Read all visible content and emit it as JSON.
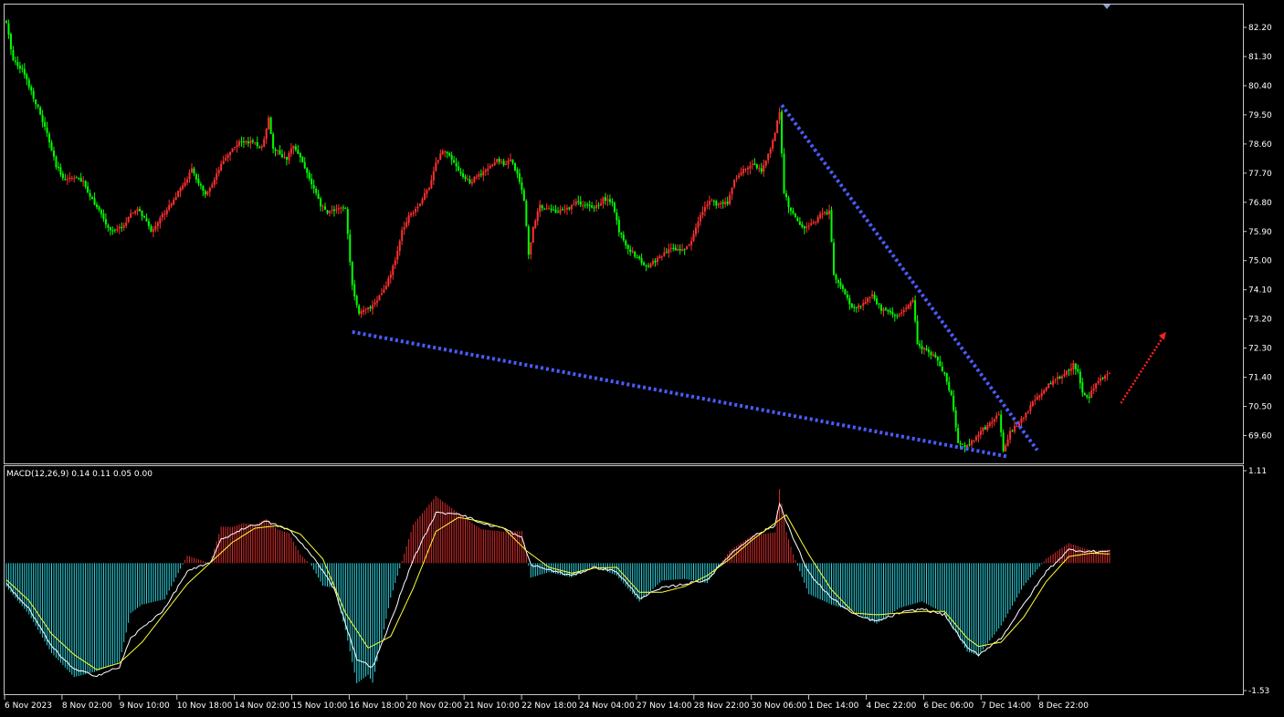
{
  "chart_data": [
    {
      "type": "candlestick",
      "instrument": "",
      "ylim": [
        68.8,
        83.0
      ],
      "y_ticks": [
        "82.20",
        "81.30",
        "80.40",
        "79.50",
        "78.60",
        "77.70",
        "76.80",
        "75.90",
        "75.00",
        "74.10",
        "73.20",
        "72.30",
        "71.40",
        "70.50",
        "69.60"
      ],
      "x_ticks": [
        "6 Nov 2023",
        "8 Nov 02:00",
        "9 Nov 10:00",
        "10 Nov 18:00",
        "14 Nov 02:00",
        "15 Nov 10:00",
        "16 Nov 18:00",
        "20 Nov 02:00",
        "21 Nov 10:00",
        "22 Nov 18:00",
        "24 Nov 04:00",
        "27 Nov 14:00",
        "28 Nov 22:00",
        "30 Nov 06:00",
        "1 Dec 14:00",
        "4 Dec 22:00",
        "6 Dec 06:00",
        "7 Dec 14:00",
        "8 Dec 22:00"
      ],
      "colors": {
        "bull": "#ff3030",
        "bear": "#00ff00",
        "trendline": "#4a5cff",
        "arrow": "#ff2020"
      },
      "close_path": [
        [
          0,
          82.3
        ],
        [
          3,
          81.2
        ],
        [
          7,
          80.9
        ],
        [
          10,
          80.4
        ],
        [
          14,
          79.7
        ],
        [
          18,
          78.9
        ],
        [
          22,
          77.9
        ],
        [
          26,
          77.5
        ],
        [
          30,
          77.6
        ],
        [
          34,
          77.4
        ],
        [
          38,
          76.9
        ],
        [
          42,
          76.4
        ],
        [
          45,
          76.0
        ],
        [
          48,
          75.9
        ],
        [
          52,
          76.1
        ],
        [
          55,
          76.4
        ],
        [
          58,
          76.6
        ],
        [
          61,
          76.3
        ],
        [
          64,
          75.9
        ],
        [
          67,
          76.2
        ],
        [
          70,
          76.5
        ],
        [
          74,
          76.9
        ],
        [
          78,
          77.3
        ],
        [
          82,
          77.8
        ],
        [
          85,
          77.4
        ],
        [
          88,
          77.0
        ],
        [
          91,
          77.3
        ],
        [
          94,
          77.8
        ],
        [
          98,
          78.3
        ],
        [
          102,
          78.6
        ],
        [
          106,
          78.7
        ],
        [
          110,
          78.6
        ],
        [
          113,
          78.5
        ],
        [
          116,
          79.4
        ],
        [
          118,
          78.5
        ],
        [
          121,
          78.3
        ],
        [
          124,
          78.1
        ],
        [
          127,
          78.6
        ],
        [
          130,
          78.2
        ],
        [
          133,
          77.7
        ],
        [
          136,
          77.2
        ],
        [
          139,
          76.7
        ],
        [
          142,
          76.5
        ],
        [
          146,
          76.6
        ],
        [
          150,
          76.6
        ],
        [
          153,
          74.2
        ],
        [
          156,
          73.4
        ],
        [
          160,
          73.5
        ],
        [
          164,
          73.8
        ],
        [
          168,
          74.2
        ],
        [
          172,
          75.0
        ],
        [
          175,
          75.9
        ],
        [
          178,
          76.4
        ],
        [
          181,
          76.6
        ],
        [
          184,
          76.9
        ],
        [
          187,
          77.3
        ],
        [
          190,
          78.0
        ],
        [
          193,
          78.4
        ],
        [
          196,
          78.3
        ],
        [
          199,
          77.9
        ],
        [
          202,
          77.6
        ],
        [
          205,
          77.4
        ],
        [
          208,
          77.6
        ],
        [
          211,
          77.7
        ],
        [
          214,
          77.9
        ],
        [
          217,
          78.1
        ],
        [
          220,
          78.0
        ],
        [
          223,
          78.1
        ],
        [
          226,
          77.7
        ],
        [
          229,
          76.9
        ],
        [
          231,
          75.2
        ],
        [
          233,
          76.0
        ],
        [
          236,
          76.7
        ],
        [
          240,
          76.6
        ],
        [
          244,
          76.5
        ],
        [
          248,
          76.6
        ],
        [
          252,
          76.8
        ],
        [
          256,
          76.7
        ],
        [
          260,
          76.6
        ],
        [
          264,
          76.9
        ],
        [
          268,
          76.8
        ],
        [
          271,
          75.9
        ],
        [
          275,
          75.4
        ],
        [
          279,
          75.1
        ],
        [
          283,
          74.8
        ],
        [
          287,
          75.0
        ],
        [
          291,
          75.2
        ],
        [
          295,
          75.4
        ],
        [
          299,
          75.3
        ],
        [
          303,
          75.6
        ],
        [
          307,
          76.4
        ],
        [
          311,
          76.9
        ],
        [
          315,
          76.7
        ],
        [
          319,
          76.8
        ],
        [
          322,
          77.5
        ],
        [
          326,
          77.8
        ],
        [
          330,
          78.0
        ],
        [
          334,
          77.8
        ],
        [
          338,
          78.4
        ],
        [
          342,
          79.6
        ],
        [
          344,
          77.1
        ],
        [
          347,
          76.5
        ],
        [
          350,
          76.2
        ],
        [
          353,
          76.0
        ],
        [
          356,
          76.1
        ],
        [
          360,
          76.4
        ],
        [
          364,
          76.5
        ],
        [
          366,
          74.6
        ],
        [
          369,
          74.2
        ],
        [
          372,
          73.8
        ],
        [
          375,
          73.5
        ],
        [
          379,
          73.7
        ],
        [
          383,
          73.9
        ],
        [
          387,
          73.5
        ],
        [
          391,
          73.4
        ],
        [
          395,
          73.3
        ],
        [
          399,
          73.6
        ],
        [
          401,
          73.8
        ],
        [
          403,
          72.4
        ],
        [
          407,
          72.2
        ],
        [
          411,
          72.0
        ],
        [
          415,
          71.5
        ],
        [
          418,
          70.8
        ],
        [
          421,
          69.4
        ],
        [
          424,
          69.2
        ],
        [
          428,
          69.5
        ],
        [
          432,
          69.8
        ],
        [
          436,
          70.0
        ],
        [
          439,
          70.3
        ],
        [
          441,
          69.1
        ],
        [
          444,
          69.7
        ],
        [
          448,
          70.0
        ],
        [
          452,
          70.4
        ],
        [
          456,
          70.8
        ],
        [
          460,
          71.1
        ],
        [
          464,
          71.3
        ],
        [
          468,
          71.5
        ],
        [
          472,
          71.8
        ],
        [
          474,
          71.6
        ],
        [
          476,
          70.9
        ],
        [
          479,
          70.8
        ],
        [
          482,
          71.2
        ],
        [
          485,
          71.4
        ],
        [
          488,
          71.5
        ]
      ],
      "lower_trendline": [
        [
          153,
          72.8
        ],
        [
          443,
          68.95
        ]
      ],
      "upper_trendline": [
        [
          343,
          79.8
        ],
        [
          456,
          69.15
        ]
      ],
      "forecast_arrow": [
        [
          493,
          70.6
        ],
        [
          513,
          72.8
        ]
      ]
    },
    {
      "type": "macd",
      "label": "MACD(12,26,9) 0.14 0.11 0.05 0.00",
      "ylim": [
        -1.53,
        1.11
      ],
      "y_ticks": [
        "1.11",
        "-1.53"
      ],
      "colors": {
        "hist_pos": "#dc2d2d",
        "hist_neg": "#2ed7e3",
        "macd": "#ffffff",
        "signal": "#ffff33"
      },
      "macd_path": [
        [
          0,
          -0.25
        ],
        [
          10,
          -0.55
        ],
        [
          20,
          -1.0
        ],
        [
          30,
          -1.28
        ],
        [
          40,
          -1.35
        ],
        [
          50,
          -1.25
        ],
        [
          55,
          -0.9
        ],
        [
          60,
          -0.78
        ],
        [
          70,
          -0.55
        ],
        [
          80,
          -0.1
        ],
        [
          90,
          0.0
        ],
        [
          95,
          0.28
        ],
        [
          105,
          0.42
        ],
        [
          115,
          0.5
        ],
        [
          125,
          0.4
        ],
        [
          135,
          0.1
        ],
        [
          145,
          -0.3
        ],
        [
          155,
          -1.15
        ],
        [
          162,
          -1.25
        ],
        [
          170,
          -0.7
        ],
        [
          180,
          0.05
        ],
        [
          190,
          0.6
        ],
        [
          200,
          0.6
        ],
        [
          210,
          0.48
        ],
        [
          220,
          0.42
        ],
        [
          228,
          0.3
        ],
        [
          232,
          -0.02
        ],
        [
          240,
          -0.08
        ],
        [
          250,
          -0.15
        ],
        [
          260,
          -0.05
        ],
        [
          270,
          -0.1
        ],
        [
          280,
          -0.42
        ],
        [
          290,
          -0.3
        ],
        [
          300,
          -0.25
        ],
        [
          310,
          -0.2
        ],
        [
          320,
          0.1
        ],
        [
          330,
          0.32
        ],
        [
          340,
          0.45
        ],
        [
          342,
          0.72
        ],
        [
          348,
          0.3
        ],
        [
          355,
          -0.12
        ],
        [
          365,
          -0.42
        ],
        [
          375,
          -0.62
        ],
        [
          385,
          -0.7
        ],
        [
          395,
          -0.6
        ],
        [
          405,
          -0.55
        ],
        [
          415,
          -0.62
        ],
        [
          425,
          -1.02
        ],
        [
          430,
          -1.1
        ],
        [
          440,
          -0.9
        ],
        [
          450,
          -0.5
        ],
        [
          460,
          -0.1
        ],
        [
          470,
          0.16
        ],
        [
          480,
          0.14
        ],
        [
          488,
          0.14
        ]
      ],
      "signal_path": [
        [
          0,
          -0.2
        ],
        [
          10,
          -0.45
        ],
        [
          20,
          -0.85
        ],
        [
          30,
          -1.1
        ],
        [
          40,
          -1.28
        ],
        [
          50,
          -1.2
        ],
        [
          60,
          -0.95
        ],
        [
          70,
          -0.6
        ],
        [
          80,
          -0.25
        ],
        [
          90,
          0.0
        ],
        [
          100,
          0.25
        ],
        [
          110,
          0.42
        ],
        [
          120,
          0.45
        ],
        [
          130,
          0.35
        ],
        [
          140,
          0.05
        ],
        [
          150,
          -0.6
        ],
        [
          160,
          -1.02
        ],
        [
          170,
          -0.88
        ],
        [
          180,
          -0.3
        ],
        [
          190,
          0.38
        ],
        [
          200,
          0.55
        ],
        [
          210,
          0.5
        ],
        [
          220,
          0.42
        ],
        [
          230,
          0.15
        ],
        [
          240,
          -0.05
        ],
        [
          250,
          -0.12
        ],
        [
          260,
          -0.06
        ],
        [
          270,
          -0.05
        ],
        [
          280,
          -0.35
        ],
        [
          290,
          -0.35
        ],
        [
          300,
          -0.28
        ],
        [
          310,
          -0.15
        ],
        [
          320,
          0.05
        ],
        [
          330,
          0.28
        ],
        [
          340,
          0.48
        ],
        [
          345,
          0.58
        ],
        [
          355,
          0.1
        ],
        [
          365,
          -0.32
        ],
        [
          375,
          -0.6
        ],
        [
          385,
          -0.62
        ],
        [
          395,
          -0.6
        ],
        [
          405,
          -0.58
        ],
        [
          415,
          -0.58
        ],
        [
          425,
          -0.9
        ],
        [
          430,
          -1.0
        ],
        [
          440,
          -0.95
        ],
        [
          450,
          -0.65
        ],
        [
          460,
          -0.22
        ],
        [
          470,
          0.08
        ],
        [
          480,
          0.12
        ],
        [
          488,
          0.11
        ]
      ]
    }
  ]
}
